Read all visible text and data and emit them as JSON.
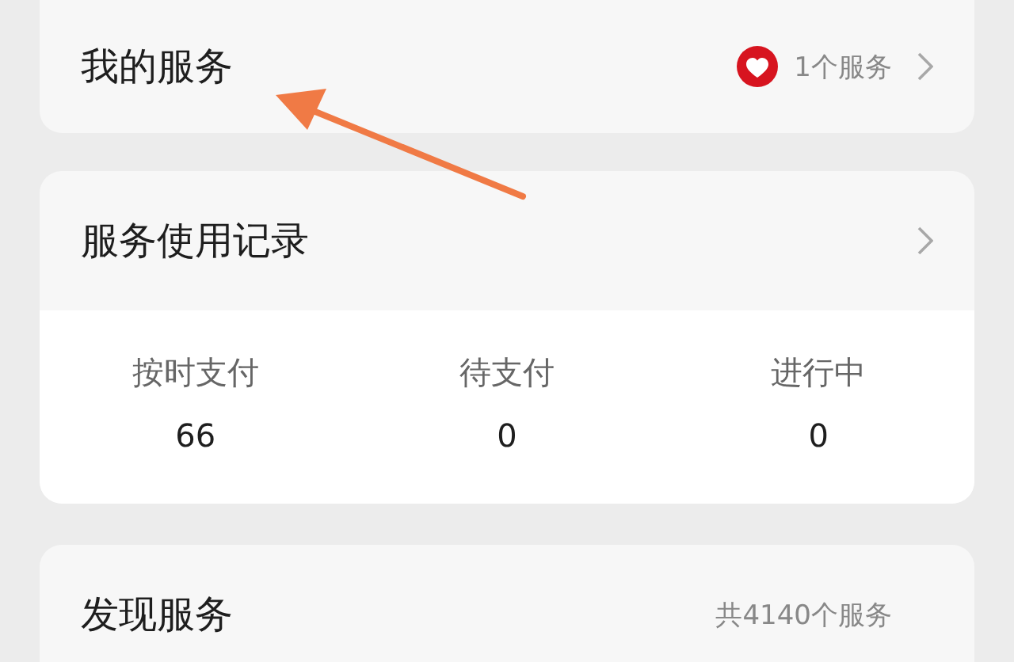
{
  "my_services": {
    "title": "我的服务",
    "count": "1个服务"
  },
  "usage_records": {
    "title": "服务使用记录",
    "stats": [
      {
        "label": "按时支付",
        "value": "66"
      },
      {
        "label": "待支付",
        "value": "0"
      },
      {
        "label": "进行中",
        "value": "0"
      }
    ]
  },
  "discover": {
    "title": "发现服务",
    "count": "共4140个服务"
  }
}
